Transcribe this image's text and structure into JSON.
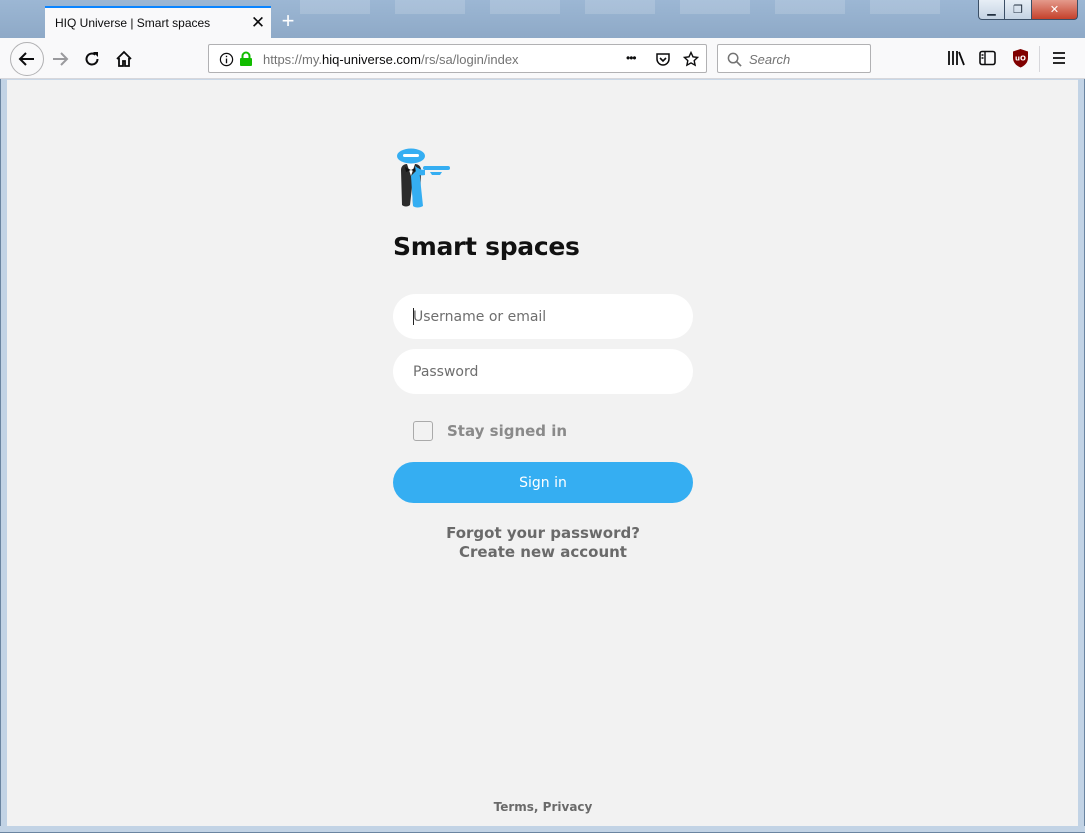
{
  "browser": {
    "tab_title": "HIQ Universe | Smart spaces",
    "tab_close": "✕",
    "new_tab": "+",
    "url_prefix": "https://my.",
    "url_host": "hiq-universe.com",
    "url_path": "/rs/sa/login/index",
    "page_actions": "•••",
    "search_placeholder": "Search"
  },
  "login": {
    "title": "Smart spaces",
    "username_placeholder": "Username or email",
    "password_placeholder": "Password",
    "stay_signed_in": "Stay signed in",
    "stay_signed_in_checked": false,
    "signin_label": "Sign in",
    "forgot_link": "Forgot your password?",
    "create_link": "Create new account",
    "footer": "Terms, Privacy"
  },
  "colors": {
    "accent": "#35aef2",
    "background": "#f2f2f2",
    "link": "#6a6a6a"
  }
}
